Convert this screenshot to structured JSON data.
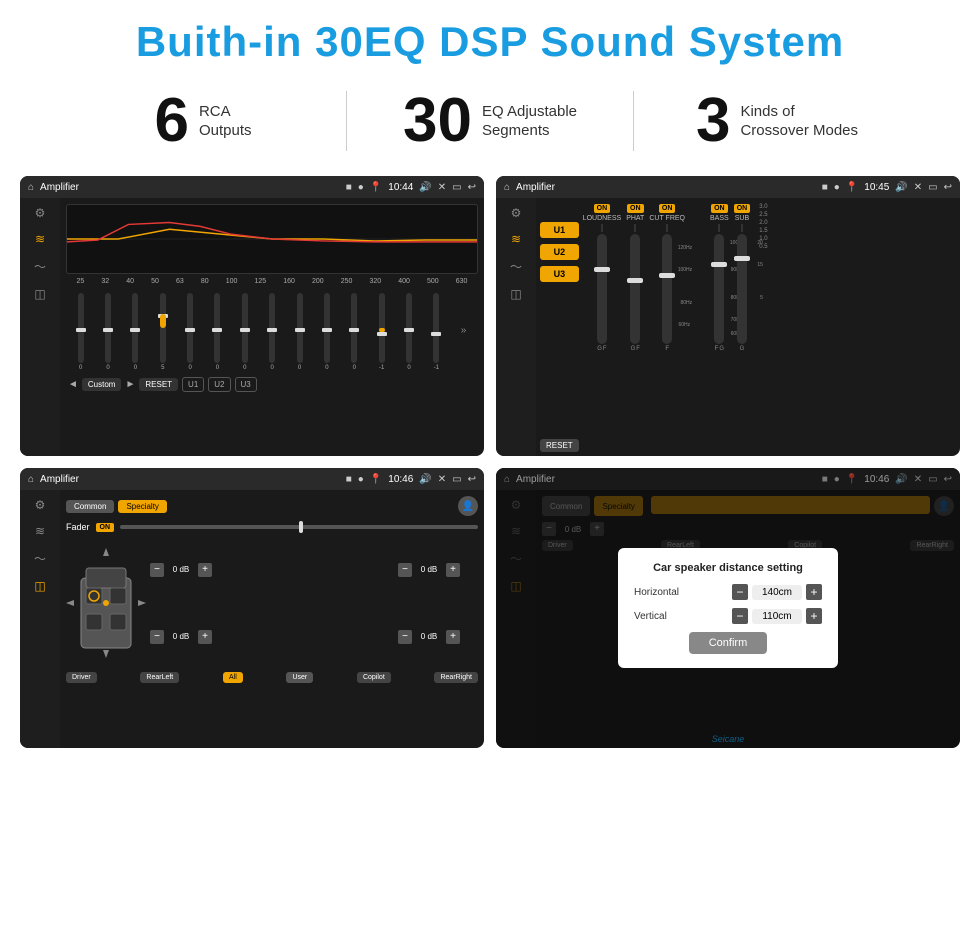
{
  "header": {
    "title": "Buith-in 30EQ DSP Sound System"
  },
  "stats": [
    {
      "number": "6",
      "text": "RCA\nOutputs"
    },
    {
      "number": "30",
      "text": "EQ Adjustable\nSegments"
    },
    {
      "number": "3",
      "text": "Kinds of\nCrossover Modes"
    }
  ],
  "screen1": {
    "title": "Amplifier",
    "time": "10:44",
    "freqs": [
      "25",
      "32",
      "40",
      "50",
      "63",
      "80",
      "100",
      "125",
      "160",
      "200",
      "250",
      "320",
      "400",
      "500",
      "630"
    ],
    "values": [
      "0",
      "0",
      "0",
      "5",
      "0",
      "0",
      "0",
      "0",
      "0",
      "0",
      "0",
      "-1",
      "0",
      "-1"
    ],
    "mode": "Custom",
    "buttons": [
      "RESET",
      "U1",
      "U2",
      "U3"
    ]
  },
  "screen2": {
    "title": "Amplifier",
    "time": "10:45",
    "channels": [
      "LOUDNESS",
      "PHAT",
      "CUT FREQ",
      "BASS",
      "SUB"
    ],
    "toggles": [
      "ON",
      "ON",
      "ON",
      "ON",
      "ON"
    ],
    "selectors": [
      "U1",
      "U2",
      "U3"
    ],
    "reset": "RESET"
  },
  "screen3": {
    "title": "Amplifier",
    "time": "10:46",
    "tabs": [
      "Common",
      "Specialty"
    ],
    "fader": "Fader",
    "faderOn": "ON",
    "controls": {
      "topLeft": "0 dB",
      "topRight": "0 dB",
      "bottomLeft": "0 dB",
      "bottomRight": "0 dB"
    },
    "buttons": {
      "driver": "Driver",
      "rearLeft": "RearLeft",
      "all": "All",
      "user": "User",
      "copilot": "Copilot",
      "rearRight": "RearRight"
    }
  },
  "screen4": {
    "title": "Amplifier",
    "time": "10:46",
    "tabs": [
      "Common",
      "Specialty"
    ],
    "dialog": {
      "title": "Car speaker distance setting",
      "horizontal_label": "Horizontal",
      "horizontal_value": "140cm",
      "vertical_label": "Vertical",
      "vertical_value": "110cm",
      "confirm": "Confirm",
      "rightDb": "0 dB"
    },
    "buttons": {
      "driver": "Driver",
      "rearLeft": "RearLeft",
      "copilot": "Copilot",
      "rearRight": "RearRight"
    }
  },
  "watermark": "Seicane"
}
